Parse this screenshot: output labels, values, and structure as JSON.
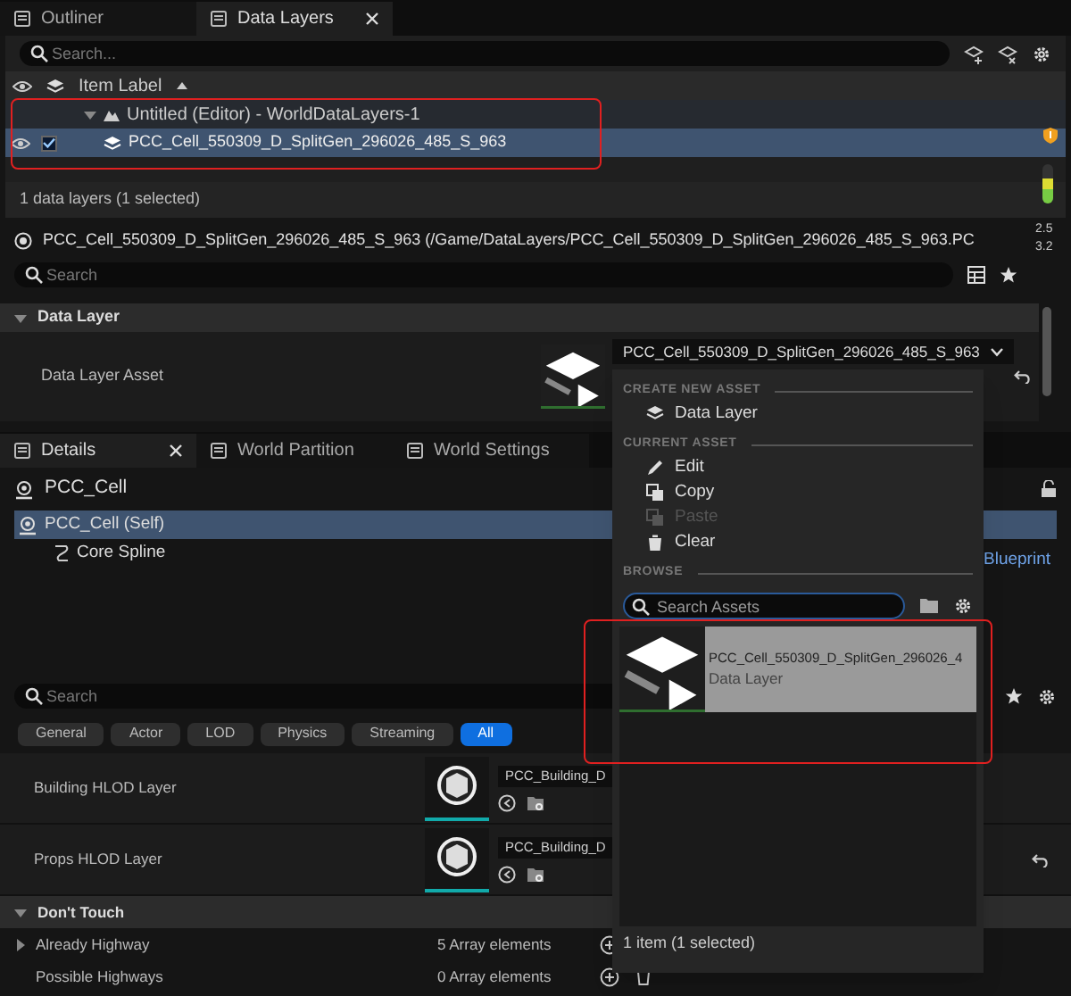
{
  "top_tabs": [
    {
      "label": "Outliner",
      "selected": false
    },
    {
      "label": "Data Layers",
      "selected": true
    }
  ],
  "outliner": {
    "search": {
      "placeholder": "Search..."
    },
    "header": "Item Label",
    "tree": [
      {
        "label": "Untitled (Editor) - WorldDataLayers-1",
        "expanded": true,
        "selected": false,
        "children": [
          {
            "label": "PCC_Cell_550309_D_SplitGen_296026_485_S_963",
            "selected": true,
            "checked": true
          }
        ]
      }
    ],
    "status": "1 data layers (1 selected)"
  },
  "stats": [
    "2.5",
    "3.2"
  ],
  "asset_details": {
    "title": "PCC_Cell_550309_D_SplitGen_296026_485_S_963 (/Game/DataLayers/PCC_Cell_550309_D_SplitGen_296026_485_S_963.PC",
    "search": {
      "placeholder": "Search"
    },
    "section": "Data Layer",
    "rows": [
      {
        "label": "Data Layer Asset",
        "value": "PCC_Cell_550309_D_SplitGen_296026_485_S_963",
        "resettable": true
      }
    ]
  },
  "details_tabs": [
    {
      "label": "Details",
      "selected": true
    },
    {
      "label": "World Partition",
      "selected": false
    },
    {
      "label": "World Settings",
      "selected": false
    }
  ],
  "details": {
    "actor": "PCC_Cell",
    "link": "Blueprint",
    "components": [
      {
        "label": "PCC_Cell (Self)",
        "selected": true,
        "children": [
          {
            "label": "Core Spline",
            "selected": false
          }
        ]
      }
    ],
    "search": {
      "placeholder": "Search"
    },
    "filters": [
      {
        "label": "General",
        "selected": false
      },
      {
        "label": "Actor",
        "selected": false
      },
      {
        "label": "LOD",
        "selected": false
      },
      {
        "label": "Physics",
        "selected": false
      },
      {
        "label": "Streaming",
        "selected": false
      },
      {
        "label": "All",
        "selected": true
      }
    ],
    "rows": [
      {
        "label": "Building HLOD Layer",
        "value": "PCC_Building_D",
        "resettable": false
      },
      {
        "label": "Props HLOD Layer",
        "value": "PCC_Building_D",
        "resettable": true
      }
    ],
    "sections": [
      {
        "title": "Don't Touch",
        "expanded": true,
        "rows": [
          {
            "label": "Already Highway",
            "value": "5 Array elements",
            "expanded": false
          },
          {
            "label": "Possible Highways",
            "value": "0 Array elements",
            "removable": true
          }
        ]
      }
    ]
  },
  "asset_menu": {
    "sections": [
      {
        "title": "CREATE NEW ASSET",
        "items": [
          {
            "label": "Data Layer",
            "kind": "layer",
            "disabled": false
          }
        ]
      },
      {
        "title": "CURRENT ASSET",
        "items": [
          {
            "label": "Edit",
            "kind": "edit",
            "disabled": false
          },
          {
            "label": "Copy",
            "kind": "copy",
            "disabled": false
          },
          {
            "label": "Paste",
            "kind": "paste",
            "disabled": true
          },
          {
            "label": "Clear",
            "kind": "clear",
            "disabled": false
          }
        ]
      },
      {
        "title": "BROWSE"
      }
    ],
    "search": {
      "placeholder": "Search Assets"
    },
    "assets": [
      {
        "name": "PCC_Cell_550309_D_SplitGen_296026_4",
        "type": "Data Layer",
        "selected": true
      }
    ],
    "status": "1 item (1 selected)"
  }
}
